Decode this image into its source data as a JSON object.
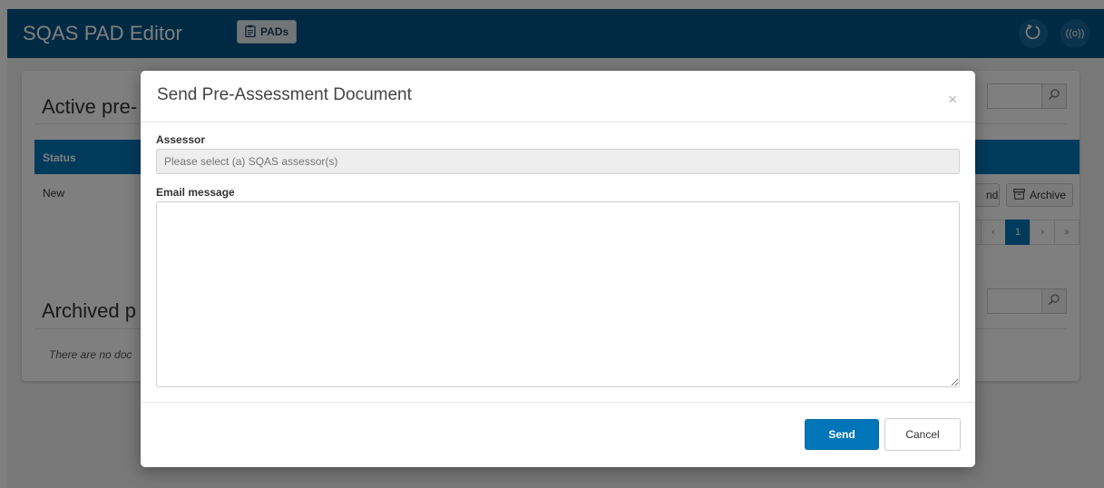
{
  "app": {
    "title": "SQAS PAD Editor",
    "nav_button": "PADs",
    "nav_icon": "clipboard-icon"
  },
  "header_icons": [
    "refresh-icon",
    "broadcast-icon"
  ],
  "active_panel": {
    "title": "Active pre-",
    "table": {
      "headers": [
        "Status"
      ],
      "rows": [
        {
          "status": "New"
        }
      ]
    },
    "row_actions": [
      "nd",
      "Archive"
    ],
    "pagination": {
      "first": "«",
      "prev": "‹",
      "current": "1",
      "next": "›",
      "last": "»"
    }
  },
  "archived_panel": {
    "title": "Archived p",
    "empty_message": "There are no doc"
  },
  "modal": {
    "title": "Send Pre-Assessment Document",
    "close": "×",
    "assessor_label": "Assessor",
    "assessor_placeholder": "Please select (a) SQAS assessor(s)",
    "email_label": "Email message",
    "email_value": "",
    "send_label": "Send",
    "cancel_label": "Cancel"
  },
  "colors": {
    "header": "#005486",
    "primary": "#0076b9",
    "backdrop": "rgba(0,0,0,0.5)"
  }
}
